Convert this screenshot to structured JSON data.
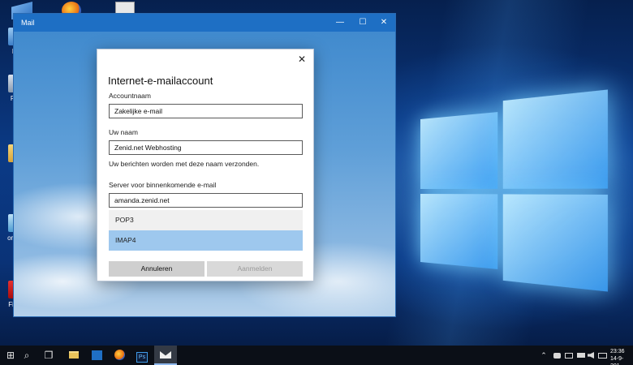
{
  "desktop": {
    "icons": [
      {
        "label": "De",
        "icon": "recycle-bin-icon"
      },
      {
        "label": "Prul",
        "icon": "trash-icon"
      },
      {
        "label": "A",
        "icon": "folder-icon"
      },
      {
        "label": "onfigu",
        "icon": "config-icon"
      },
      {
        "label": "FileZi",
        "icon": "filezilla-icon"
      }
    ]
  },
  "mail_window": {
    "title": "Mail",
    "minimize": "—",
    "maximize": "☐",
    "close": "✕"
  },
  "dialog": {
    "close": "✕",
    "title": "Internet-e-mailaccount",
    "account_name_label": "Accountnaam",
    "account_name_value": "Zakelijke e-mail",
    "your_name_label": "Uw naam",
    "your_name_value": "Zenid.net Webhosting",
    "your_name_hint": "Uw berichten worden met deze naam verzonden.",
    "incoming_server_label": "Server voor binnenkomende e-mail",
    "incoming_server_value": "amanda.zenid.net",
    "account_type_options": [
      "POP3",
      "IMAP4"
    ],
    "account_type_selected": "IMAP4",
    "cancel_label": "Annuleren",
    "signin_label": "Aanmelden"
  },
  "taskbar": {
    "start": "⊞",
    "search": "⌕",
    "task_view": "❐",
    "apps": [
      "file-explorer-icon",
      "outlook-icon",
      "firefox-icon",
      "photoshop-icon",
      "mail-icon"
    ],
    "photoshop_label": "Ps",
    "tray": {
      "chevron": "⌃",
      "clock_time": "23:36",
      "clock_date": "14-9-201"
    }
  },
  "colors": {
    "titlebar": "#1e6fc4",
    "selected_option": "#9ec8ee",
    "taskbar": "#0b0f17"
  }
}
